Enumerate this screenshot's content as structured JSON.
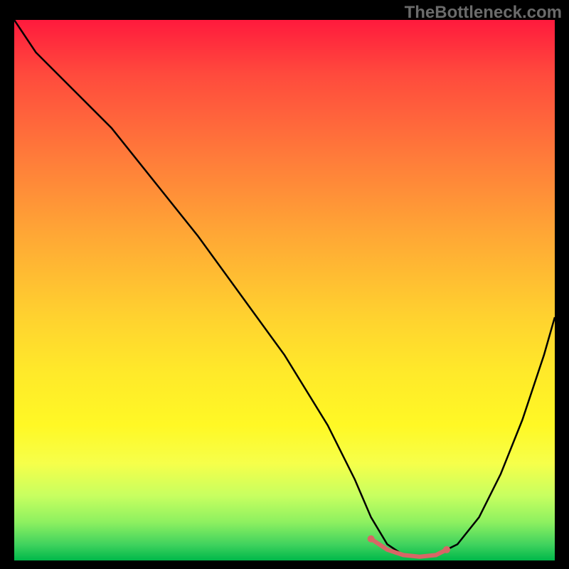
{
  "watermark": "TheBottleneck.com",
  "colors": {
    "background": "#000000",
    "curve": "#000000",
    "highlight": "#d86666",
    "watermark": "#6b6b6b",
    "gradient_top": "#ff1a3d",
    "gradient_mid": "#ffe92a",
    "gradient_bottom": "#00b84a"
  },
  "chart_data": {
    "type": "line",
    "title": "",
    "xlabel": "",
    "ylabel": "",
    "xlim": [
      0,
      100
    ],
    "ylim": [
      0,
      100
    ],
    "series": [
      {
        "name": "bottleneck-curve",
        "x": [
          0,
          4,
          8,
          12,
          18,
          26,
          34,
          42,
          50,
          58,
          63,
          66,
          69,
          72,
          75,
          78,
          82,
          86,
          90,
          94,
          98,
          100
        ],
        "y": [
          100,
          94,
          90,
          86,
          80,
          70,
          60,
          49,
          38,
          25,
          15,
          8,
          3,
          1,
          0.5,
          1,
          3,
          8,
          16,
          26,
          38,
          45
        ]
      }
    ],
    "highlight": {
      "name": "optimal-range",
      "x": [
        66,
        69,
        72,
        75,
        78,
        80
      ],
      "y": [
        4,
        2,
        1,
        0.7,
        1,
        2
      ]
    },
    "annotations": []
  }
}
